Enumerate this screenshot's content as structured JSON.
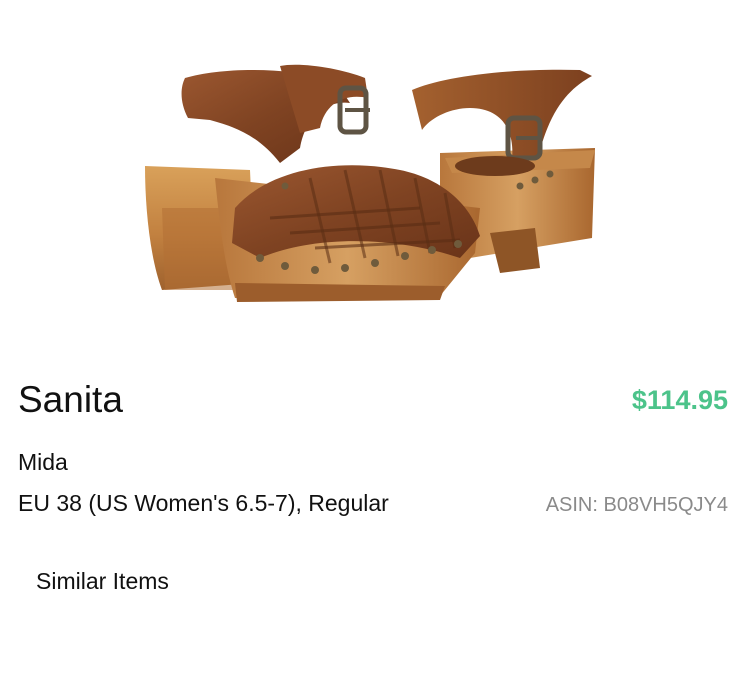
{
  "product": {
    "image_alt": "Brown leather clog sandal with wooden heel",
    "brand": "Sanita",
    "price": "$114.95",
    "model": "Mida",
    "size": "EU 38 (US Women's 6.5-7), Regular",
    "asin": "ASIN: B08VH5QJY4"
  },
  "links": {
    "similar_items": "Similar Items"
  },
  "colors": {
    "price": "#4cc38a",
    "secondary_text": "#8a8a8a",
    "leather": "#8b4a26",
    "wood": "#c98a45"
  }
}
